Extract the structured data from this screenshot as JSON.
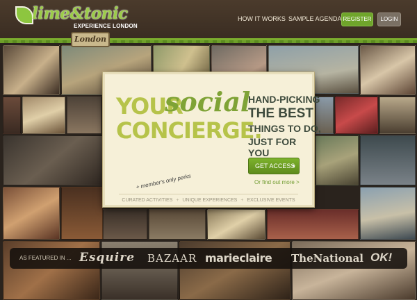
{
  "header": {
    "logo_text": "lime&tonic",
    "logo_sub": "EXPERIENCE LONDON",
    "city": "London",
    "nav": {
      "how_it_works": "HOW IT WORKS",
      "sample_agenda": "SAMPLE AGENDA",
      "register": "REGISTER",
      "login": "LOGIN"
    },
    "colors": {
      "brand_green": "#8dc63f",
      "header_brown": "#3f3126"
    }
  },
  "card": {
    "headline": {
      "your": "YOUR",
      "social": "social",
      "concierge": "CONCIERGE."
    },
    "tagline": {
      "line1": "HAND-PICKING",
      "line2": "THE BEST",
      "line3": "THINGS TO DO,",
      "line4": "JUST FOR YOU"
    },
    "cta": {
      "label": "GET ACCESS",
      "arrow_icon": "chevron-right-icon"
    },
    "find_out_link": "Or find out more >",
    "members_note": "+ member's only perks",
    "features": [
      "CURATED ACTIVITIES",
      "UNIQUE EXPERIENCES",
      "EXCLUSIVE EVENTS"
    ],
    "bullet": "+"
  },
  "featured": {
    "label": "AS FEATURED IN ...",
    "press": [
      "Esquire",
      "BAZAAR",
      "marieclaire",
      "TheNational",
      "OK!"
    ]
  }
}
